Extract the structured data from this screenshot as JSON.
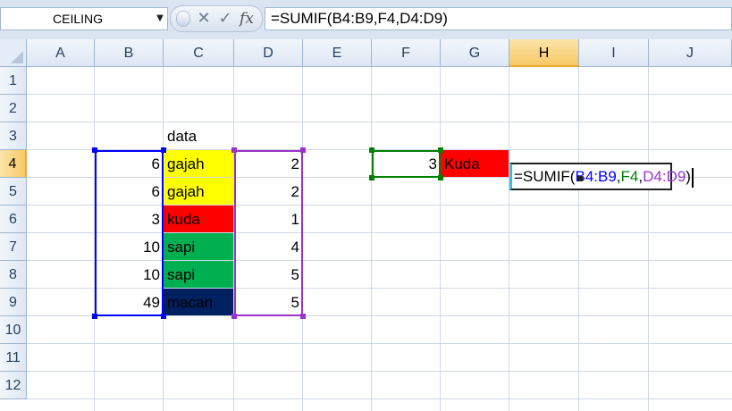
{
  "formula_bar": {
    "name_box": "CEILING",
    "cancel_glyph": "✕",
    "enter_glyph": "✓",
    "insert_function_glyph": "fx",
    "formula": "=SUMIF(B4:B9,F4,D4:D9)"
  },
  "columns": [
    "A",
    "B",
    "C",
    "D",
    "E",
    "F",
    "G",
    "H",
    "I",
    "J"
  ],
  "active_column": "H",
  "rows": [
    "1",
    "2",
    "3",
    "4",
    "5",
    "6",
    "7",
    "8",
    "9",
    "10",
    "11",
    "12"
  ],
  "active_row": "4",
  "cells": {
    "C3": "data",
    "B4": "6",
    "C4": "gajah",
    "D4": "2",
    "B5": "6",
    "C5": "gajah",
    "D5": "2",
    "B6": "3",
    "C6": "kuda",
    "D6": "1",
    "B7": "10",
    "C7": "sapi",
    "D7": "4",
    "B8": "10",
    "C8": "sapi",
    "D8": "5",
    "B9": "49",
    "C9": "macan",
    "D9": "5",
    "F4": "3",
    "G4": "Kuda"
  },
  "fill_colors": {
    "C4": "#ffff00",
    "C5": "#ffff00",
    "C6": "#ff0000",
    "C7": "#00b050",
    "C8": "#00b050",
    "C9": "#002060",
    "G4": "#ff0000"
  },
  "edit_cell": {
    "address": "H4",
    "parts": {
      "prefix": "=SUMIF(",
      "range1": "B4:B9",
      "sep1": ",",
      "criteria": "F4",
      "sep2": ",",
      "range2": "D4:D9",
      "suffix": ")"
    }
  },
  "range_colors": {
    "range1": "#0000ff",
    "criteria": "#008000",
    "range2": "#9933cc"
  }
}
